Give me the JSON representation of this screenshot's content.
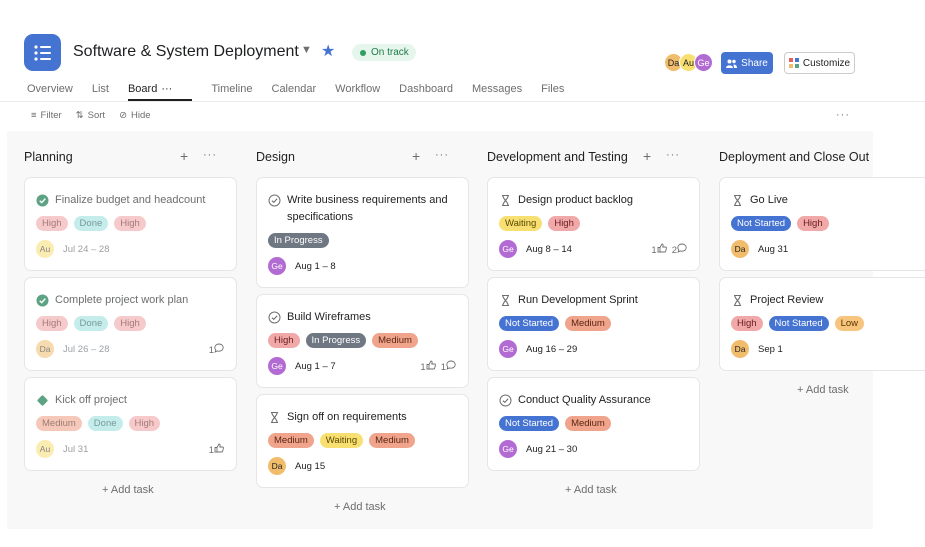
{
  "project": {
    "title": "Software & System Deployment",
    "status": "On track",
    "members": [
      "Da",
      "Au",
      "Ge"
    ],
    "share_label": "Share",
    "customize_label": "Customize"
  },
  "tabs": [
    "Overview",
    "List",
    "Board",
    "Timeline",
    "Calendar",
    "Workflow",
    "Dashboard",
    "Messages",
    "Files"
  ],
  "toolbar": {
    "filter": "Filter",
    "sort": "Sort",
    "hide": "Hide"
  },
  "colors": {
    "accent": "#4573d2",
    "pill_high": "#f1a8a8",
    "pill_done": "#9ee0de",
    "pill_medium": "#f0a48c",
    "pill_in_progress": "#6f7782",
    "pill_waiting": "#f8df72",
    "pill_not_started": "#4573d2",
    "pill_low": "#f8c57e",
    "avatar_da": "#f1bd6c",
    "avatar_au": "#f8df72",
    "avatar_ge": "#b36bd4"
  },
  "columns": [
    {
      "name": "Planning",
      "add_task": "+ Add task",
      "cards": [
        {
          "title": "Finalize budget and headcount",
          "icon": "check-circle-filled-icon",
          "done": true,
          "tags": [
            "High",
            "Done",
            "High"
          ],
          "assignee": "Au",
          "date": "Jul 24 – 28"
        },
        {
          "title": "Complete project work plan",
          "icon": "check-circle-filled-icon",
          "done": true,
          "tags": [
            "High",
            "Done",
            "High"
          ],
          "assignee": "Da",
          "date": "Jul 26 – 28",
          "comments": "1"
        },
        {
          "title": "Kick off project",
          "icon": "milestone-diamond-icon",
          "done": true,
          "tags": [
            "Medium",
            "Done",
            "High"
          ],
          "assignee": "Au",
          "date": "Jul 31",
          "likes": "1"
        }
      ]
    },
    {
      "name": "Design",
      "add_task": "+ Add task",
      "cards": [
        {
          "title": "Write business requirements and specifications",
          "icon": "check-circle-outline-icon",
          "done": false,
          "tags": [
            "In Progress"
          ],
          "assignee": "Ge",
          "date": "Aug 1 – 8"
        },
        {
          "title": "Build Wireframes",
          "icon": "check-circle-outline-icon",
          "done": false,
          "tags": [
            "High",
            "In Progress",
            "Medium"
          ],
          "assignee": "Ge",
          "date": "Aug 1 – 7",
          "likes": "1",
          "comments": "1"
        },
        {
          "title": "Sign off on requirements",
          "icon": "hourglass-icon",
          "done": false,
          "tags": [
            "Medium",
            "Waiting",
            "Medium"
          ],
          "assignee": "Da",
          "date": "Aug 15"
        }
      ]
    },
    {
      "name": "Development and Testing",
      "add_task": "+ Add task",
      "cards": [
        {
          "title": "Design product backlog",
          "icon": "hourglass-icon",
          "done": false,
          "tags": [
            "Waiting",
            "High"
          ],
          "assignee": "Ge",
          "date": "Aug 8 – 14",
          "likes": "1",
          "comments": "2"
        },
        {
          "title": "Run Development Sprint",
          "icon": "hourglass-icon",
          "done": false,
          "tags": [
            "Not Started",
            "Medium"
          ],
          "assignee": "Ge",
          "date": "Aug 16 – 29"
        },
        {
          "title": "Conduct Quality Assurance",
          "icon": "check-circle-outline-icon",
          "done": false,
          "tags": [
            "Not Started",
            "Medium"
          ],
          "assignee": "Ge",
          "date": "Aug 21 – 30"
        }
      ]
    },
    {
      "name": "Deployment and Close Out",
      "add_task": "+ Add task",
      "cards": [
        {
          "title": "Go Live",
          "icon": "hourglass-icon",
          "done": false,
          "tags": [
            "Not Started",
            "High"
          ],
          "assignee": "Da",
          "date": "Aug 31"
        },
        {
          "title": "Project Review",
          "icon": "hourglass-icon",
          "done": false,
          "tags": [
            "High",
            "Not Started",
            "Low"
          ],
          "assignee": "Da",
          "date": "Sep 1"
        }
      ]
    }
  ]
}
